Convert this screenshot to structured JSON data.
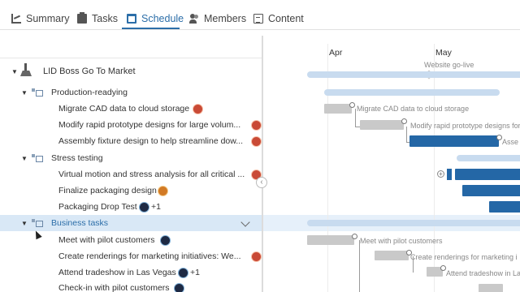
{
  "tabs": [
    {
      "label": "Summary",
      "icon": "chart-icon"
    },
    {
      "label": "Tasks",
      "icon": "clipboard-icon"
    },
    {
      "label": "Schedule",
      "icon": "calendar-icon"
    },
    {
      "label": "Members",
      "icon": "people-icon"
    },
    {
      "label": "Content",
      "icon": "document-icon"
    }
  ],
  "active_tab": "Schedule",
  "accent_color": "#2c6ea8",
  "project": {
    "name": "LID Boss Go To Market"
  },
  "groups": [
    {
      "name": "Production-readying",
      "tasks": [
        {
          "name": "Migrate CAD data to cloud storage"
        },
        {
          "name": "Modify rapid prototype designs for large volum..."
        },
        {
          "name": "Assembly fixture design to help streamline dow..."
        }
      ]
    },
    {
      "name": "Stress testing",
      "tasks": [
        {
          "name": "Virtual motion and stress analysis for all critical ..."
        },
        {
          "name": "Finalize packaging design"
        },
        {
          "name": "Packaging Drop Test",
          "extra": "+1"
        }
      ]
    },
    {
      "name": "Business tasks",
      "tasks": [
        {
          "name": "Meet with pilot customers"
        },
        {
          "name": "Create renderings for marketing initiatives: We..."
        },
        {
          "name": "Attend tradeshow in Las Vegas",
          "extra": "+1"
        },
        {
          "name": "Check-in with pilot customers"
        }
      ]
    }
  ],
  "timeline": {
    "months": [
      "Apr",
      "May"
    ],
    "milestone_label": "Website go-live",
    "bar_labels": {
      "migrate": "Migrate CAD data to cloud storage",
      "modify": "Modify rapid prototype designs for",
      "assembly": "Asse",
      "meet": "Meet with pilot customers",
      "renderings": "Create renderings for marketing i",
      "tradeshow": "Attend tradeshow in La"
    }
  }
}
